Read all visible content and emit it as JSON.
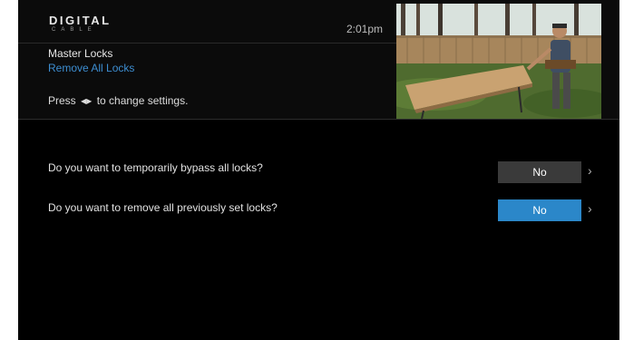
{
  "header": {
    "logo_main": "DIGITAL",
    "logo_sub": "CABLE",
    "time": "2:01pm",
    "breadcrumb": "Master Locks",
    "subtitle": "Remove All Locks",
    "hint_prefix": "Press",
    "hint_arrows": "◀▶",
    "hint_suffix": "to change settings."
  },
  "settings": [
    {
      "question": "Do you want to temporarily bypass all locks?",
      "value": "No",
      "selected": false
    },
    {
      "question": "Do you want to remove all previously set locks?",
      "value": "No",
      "selected": true
    }
  ],
  "colors": {
    "accent": "#2b87c9",
    "option_bg": "#3a3a3a",
    "background": "#000000"
  },
  "icons": {
    "arrow": "chevron-right-icon",
    "hint": "left-right-arrows-icon"
  }
}
